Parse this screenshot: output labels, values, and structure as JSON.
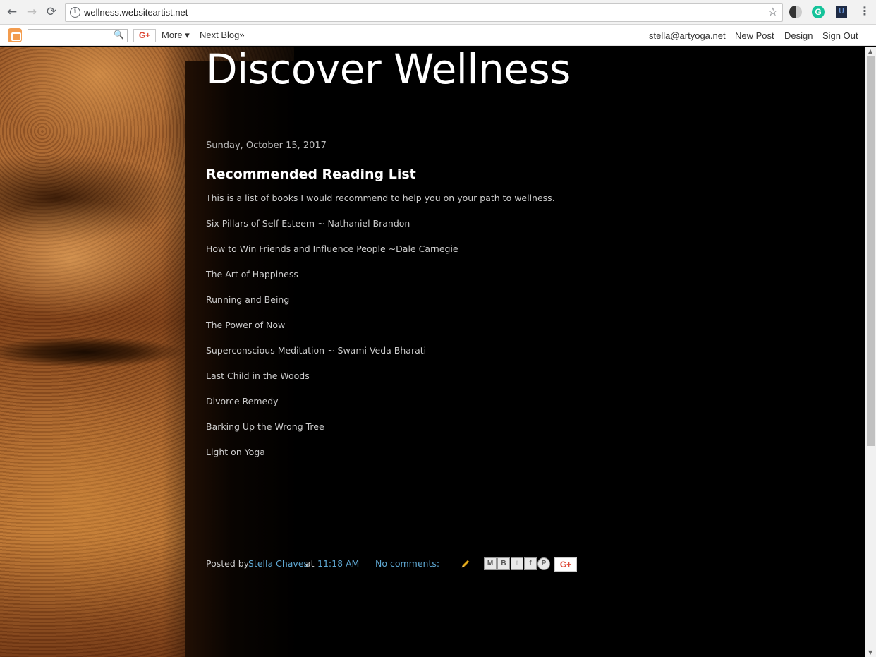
{
  "browser": {
    "back_icon": "←",
    "forward_icon": "→",
    "reload_icon": "⟳",
    "info_icon": "i",
    "url": "wellness.websiteartist.net",
    "bookmark_icon": "☆",
    "ext_grammarly": "G",
    "ext_other": "U",
    "menu_icon": "⋮"
  },
  "navbar": {
    "search_icon": "🔍",
    "gplus_label": "G+",
    "more_label": "More ▾",
    "next_blog_label": "Next Blog»",
    "user_email": "stella@artyoga.net",
    "new_post_label": "New Post",
    "design_label": "Design",
    "sign_out_label": "Sign Out"
  },
  "blog": {
    "title": "Discover Wellness"
  },
  "post": {
    "date": "Sunday, October 15, 2017",
    "title": "Recommended Reading List",
    "intro": "This is a list of books I would recommend to help you on your path to wellness.",
    "books": [
      "Six Pillars of Self Esteem ~ Nathaniel Brandon",
      "How to Win Friends and Influence People ~Dale Carnegie",
      "The Art of Happiness",
      "Running and Being",
      "The Power of Now",
      "Superconscious Meditation ~ Swami Veda Bharati",
      "Last Child in the Woods",
      "Divorce Remedy",
      "Barking Up the Wrong Tree",
      "Light on Yoga"
    ],
    "footer": {
      "posted_by": "Posted by",
      "author": "Stella Chaves",
      "at": "at",
      "time": "11:18 AM",
      "comments": "No comments:",
      "share_email": "M",
      "share_blog": "B",
      "share_twitter": "t",
      "share_facebook": "f",
      "share_pinterest": "P",
      "gplus": "G+"
    }
  },
  "colors": {
    "link": "#5fa8d3",
    "background": "#000000",
    "text": "#cccccc"
  }
}
